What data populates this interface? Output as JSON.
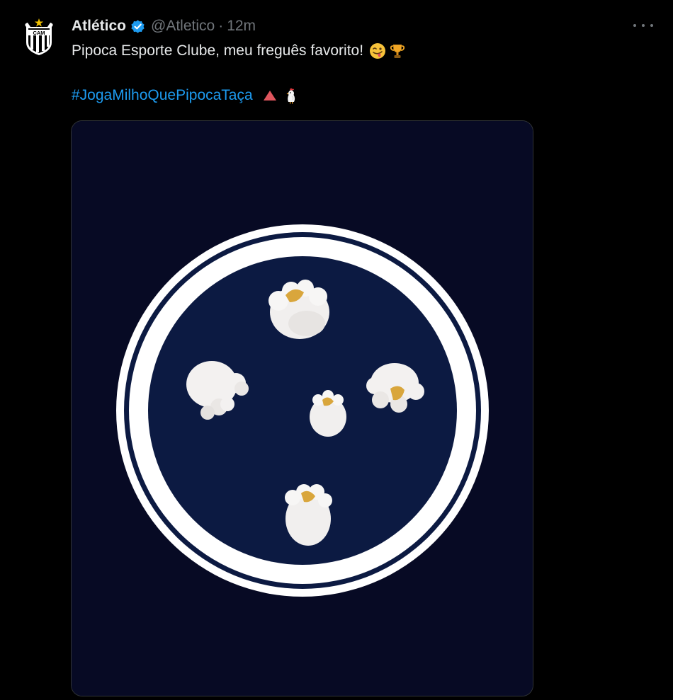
{
  "author": {
    "display_name": "Atlético",
    "handle": "@Atletico",
    "separator": "·",
    "time": "12m",
    "avatar_letters": "CAM",
    "verified_color": "#1d9bf0"
  },
  "tweet": {
    "text": "Pipoca Esporte Clube, meu freguês favorito!",
    "text_emojis": [
      "winking-face-with-tongue-emoji",
      "trophy-emoji"
    ],
    "hashtag": "#JogaMilhoQuePipocaTaça",
    "hashtag_emojis": [
      "red-triangle-emoji",
      "chicken-emoji"
    ],
    "hashtag_color": "#1d9bf0"
  },
  "media": {
    "background_color": "#070a24",
    "badge_color": "#0c1a42",
    "ring_color": "#ffffff",
    "content": "popcorn-on-crest"
  }
}
